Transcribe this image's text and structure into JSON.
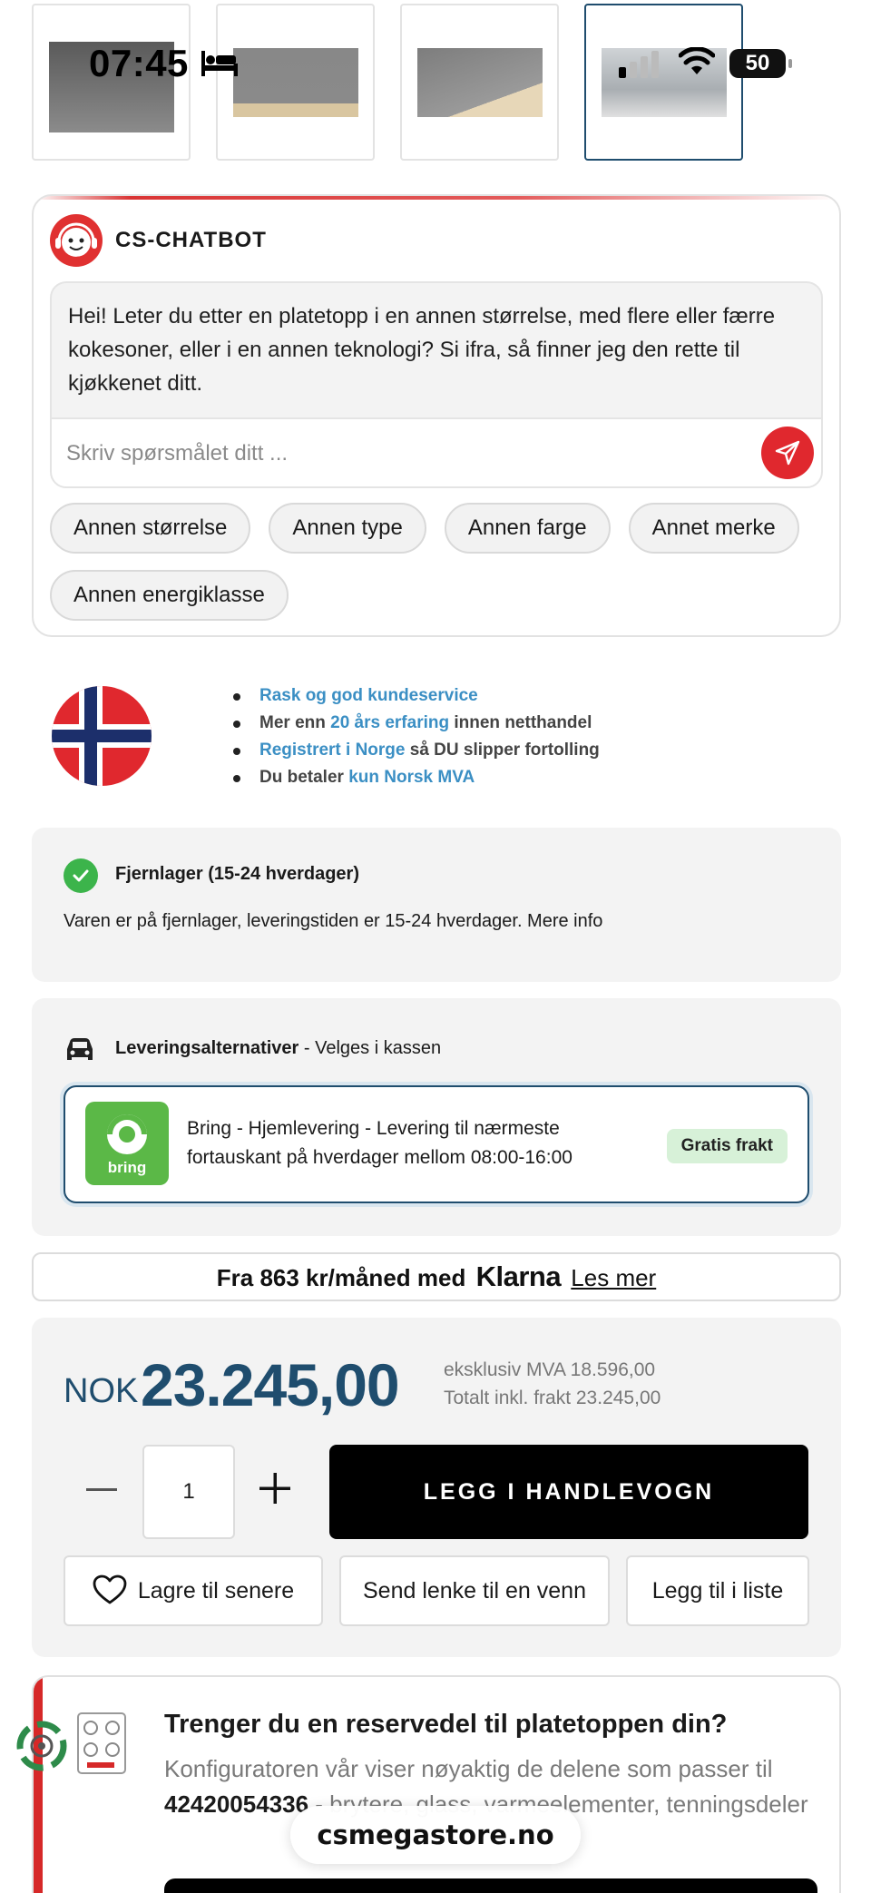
{
  "status_bar": {
    "time": "07:45",
    "battery": "50"
  },
  "gallery": {
    "thumbnails": [
      "thumb-1",
      "thumb-2",
      "thumb-3",
      "thumb-4"
    ],
    "active_index": 3
  },
  "chatbot": {
    "title": "CS-CHATBOT",
    "message": "Hei! Leter du etter en platetopp i en annen størrelse, med flere eller færre kokesoner, eller i en annen teknologi? Si ifra, så finner jeg den rette til kjøkkenet ditt.",
    "input_placeholder": "Skriv spørsmålet ditt ...",
    "chips": [
      "Annen størrelse",
      "Annen type",
      "Annen farge",
      "Annet merke",
      "Annen energiklasse"
    ]
  },
  "benefits": {
    "items": [
      {
        "pre": "",
        "highlight": "Rask og god kundeservice",
        "post": ""
      },
      {
        "pre": "Mer enn ",
        "highlight": "20 års erfaring",
        "post": " innen netthandel"
      },
      {
        "pre": "",
        "highlight": "Registrert i Norge",
        "post": " så DU slipper fortolling"
      },
      {
        "pre": "Du betaler ",
        "highlight": "kun Norsk MVA",
        "post": ""
      }
    ]
  },
  "stock": {
    "title": "Fjernlager (15-24 hverdager)",
    "description": "Varen er på fjernlager, leveringstiden er 15-24 hverdager. Mere info"
  },
  "delivery": {
    "title": "Leveringsalternativer",
    "subtitle": " - Velges i kassen",
    "option_logo_text": "bring",
    "option_text": "Bring - Hjemlevering - Levering til nærmeste fortauskant på hverdager mellom 08:00-16:00",
    "option_badge": "Gratis frakt"
  },
  "klarna": {
    "prefix": "Fra 863 kr/måned med",
    "brand": "Klarna",
    "link": "Les mer"
  },
  "price": {
    "currency": "NOK",
    "value": "23.245,00",
    "ex_vat": "eksklusiv MVA 18.596,00",
    "total": "Totalt inkl. frakt 23.245,00"
  },
  "cart": {
    "quantity": "1",
    "add_label": "LEGG I HANDLEVOGN",
    "save_label": "Lagre til senere",
    "send_label": "Send lenke til en venn",
    "list_label": "Legg til i liste"
  },
  "parts": {
    "title": "Trenger du en reservedel til platetoppen din?",
    "text_pre": "Konfiguratoren vår viser nøyaktig de delene som passer til ",
    "model": "42420054336",
    "text_post": " - brytere, glass, varmeelementer, tenningsdeler"
  },
  "browser": {
    "domain": "csmegastore.no"
  },
  "colors": {
    "accent_blue": "#1f4d6e",
    "link_blue": "#3b8fc4",
    "chat_red": "#e0282e",
    "stock_green": "#3cb44b",
    "bring_green": "#5bb847",
    "badge_green": "#d7f1d8"
  }
}
